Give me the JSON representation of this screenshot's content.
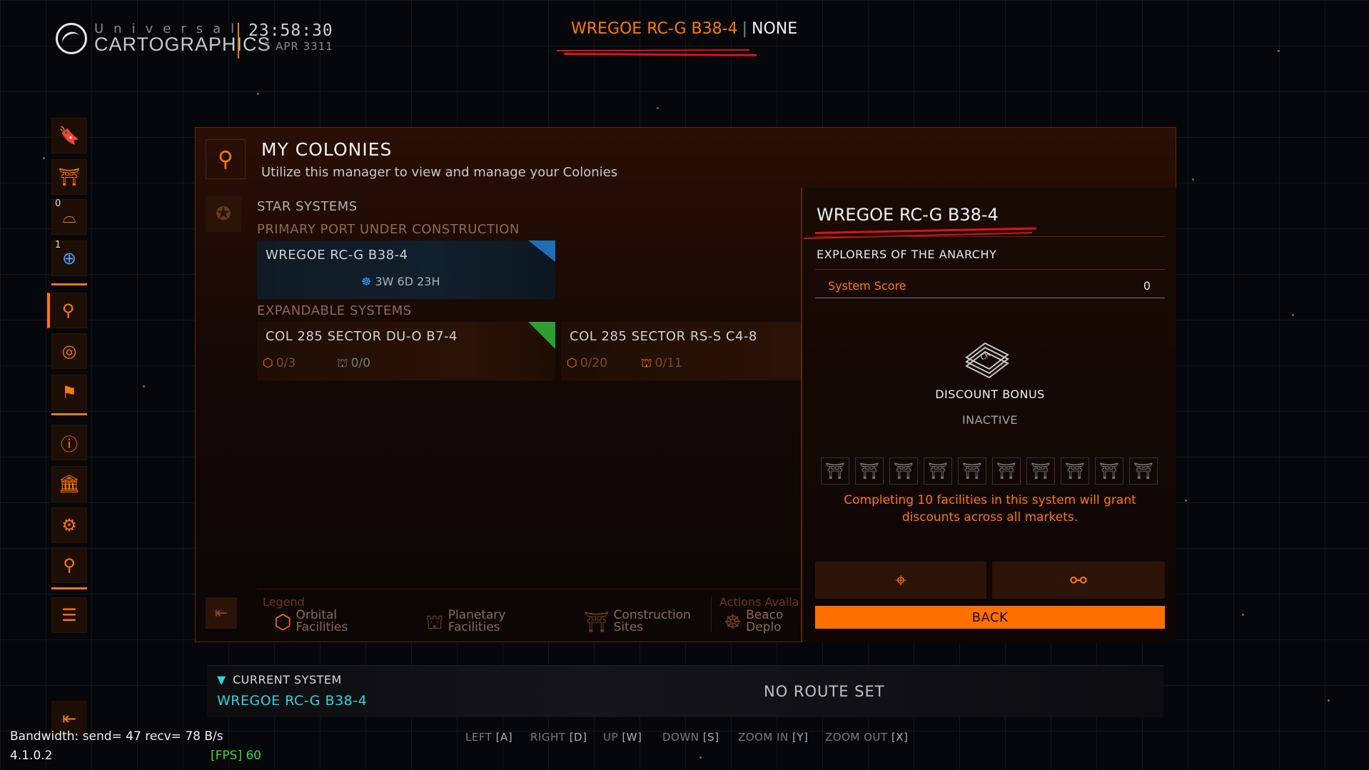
{
  "header": {
    "logo_line1": "Universal",
    "logo_line2": "CARTOGRAPHICS",
    "time": "23:58:30",
    "date": "5 APR 3311",
    "current_system": "WREGOE RC-G B38-4",
    "separator": "|",
    "target": "NONE"
  },
  "sidebar": {
    "counts": {
      "colony_count": "0",
      "system_count": "1"
    }
  },
  "panel": {
    "title": "MY COLONIES",
    "subtitle": "Utilize this manager to view and manage your Colonies",
    "star_systems_label": "STAR SYSTEMS",
    "primary_label": "PRIMARY PORT UNDER CONSTRUCTION",
    "primary_card": {
      "name": "WREGOE RC-G B38-4",
      "timer": "3W 6D 23H"
    },
    "expandable_label": "EXPANDABLE SYSTEMS",
    "expandable_cards": [
      {
        "name": "COL 285 SECTOR DU-O B7-4",
        "orbital": "0/3",
        "planetary": "0/0"
      },
      {
        "name": "COL 285 SECTOR RS-S C4-8",
        "orbital": "0/20",
        "planetary": "0/11"
      }
    ],
    "legend": {
      "title": "Legend",
      "orbital_1": "Orbital",
      "orbital_2": "Facilities",
      "planetary_1": "Planetary",
      "planetary_2": "Facilities",
      "construction_1": "Construction",
      "construction_2": "Sites",
      "actions_title": "Actions Availa",
      "beacon_1": "Beaco",
      "beacon_2": "Deplo"
    }
  },
  "detail": {
    "system_name": "WREGOE RC-G B38-4",
    "faction": "EXPLORERS OF THE ANARCHY",
    "score_label": "System Score",
    "score_value": "0",
    "discount_title": "DISCOUNT BONUS",
    "discount_status": "INACTIVE",
    "facility_slots": 10,
    "message_line1": "Completing 10 facilities in this system will grant",
    "message_line2": "discounts across all markets.",
    "back_label": "BACK"
  },
  "route": {
    "current_label": "CURRENT SYSTEM",
    "current_system": "WREGOE RC-G B38-4",
    "status": "NO ROUTE SET"
  },
  "keys": [
    {
      "label": "LEFT",
      "key": "[A]"
    },
    {
      "label": "RIGHT",
      "key": "[D]"
    },
    {
      "label": "UP",
      "key": "[W]"
    },
    {
      "label": "DOWN",
      "key": "[S]"
    },
    {
      "label": "ZOOM IN",
      "key": "[Y]"
    },
    {
      "label": "ZOOM OUT",
      "key": "[X]"
    }
  ],
  "debug": {
    "bandwidth": "Bandwidth: send=  47 recv=  78 B/s",
    "version": "4.1.0.2",
    "fps": "[FPS] 60"
  },
  "colors": {
    "accent": "#ff7a00",
    "cyan": "#29d5e0",
    "fps_green": "#39d83a",
    "annotation_red": "#e0101a"
  }
}
